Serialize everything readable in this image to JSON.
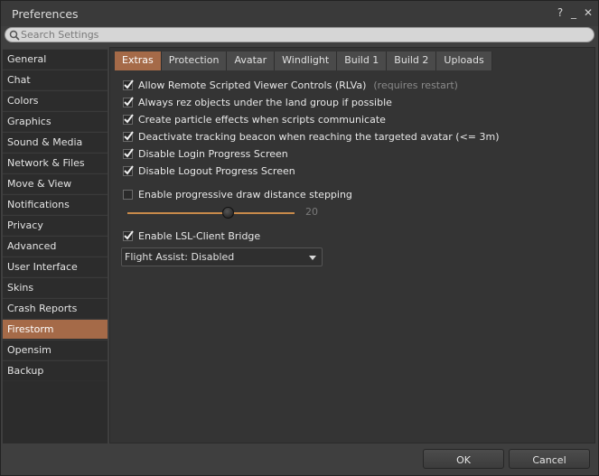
{
  "window": {
    "title": "Preferences",
    "help_glyph": "?",
    "minimize_glyph": "_",
    "close_glyph": "✕"
  },
  "search": {
    "placeholder": "Search Settings",
    "value": ""
  },
  "sidebar": {
    "items": [
      {
        "label": "General"
      },
      {
        "label": "Chat"
      },
      {
        "label": "Colors"
      },
      {
        "label": "Graphics"
      },
      {
        "label": "Sound & Media"
      },
      {
        "label": "Network & Files"
      },
      {
        "label": "Move & View"
      },
      {
        "label": "Notifications"
      },
      {
        "label": "Privacy"
      },
      {
        "label": "Advanced"
      },
      {
        "label": "User Interface"
      },
      {
        "label": "Skins"
      },
      {
        "label": "Crash Reports"
      },
      {
        "label": "Firestorm"
      },
      {
        "label": "Opensim"
      },
      {
        "label": "Backup"
      }
    ],
    "active": "Firestorm"
  },
  "tabs": {
    "items": [
      {
        "label": "Extras"
      },
      {
        "label": "Protection"
      },
      {
        "label": "Avatar"
      },
      {
        "label": "Windlight"
      },
      {
        "label": "Build 1"
      },
      {
        "label": "Build 2"
      },
      {
        "label": "Uploads"
      }
    ],
    "active": "Extras"
  },
  "options": {
    "rlva": {
      "label": "Allow Remote Scripted Viewer Controls (RLVa)",
      "hint": "(requires restart)",
      "checked": true
    },
    "rez_land_group": {
      "label": "Always rez objects under the land group if possible",
      "checked": true
    },
    "particle_effects": {
      "label": "Create particle effects when scripts communicate",
      "checked": true
    },
    "tracking_beacon": {
      "label": "Deactivate tracking beacon when reaching the targeted avatar (<= 3m)",
      "checked": true
    },
    "login_progress": {
      "label": "Disable Login Progress Screen",
      "checked": true
    },
    "logout_progress": {
      "label": "Disable Logout Progress Screen",
      "checked": true
    },
    "progressive_draw": {
      "label": "Enable progressive draw distance stepping",
      "checked": false
    },
    "lsl_bridge": {
      "label": "Enable LSL-Client Bridge",
      "checked": true
    }
  },
  "slider": {
    "value": "20",
    "fraction": 0.6
  },
  "flight_assist": {
    "selected": "Flight Assist: Disabled"
  },
  "buttons": {
    "ok": "OK",
    "cancel": "Cancel"
  },
  "colors": {
    "accent": "#a56a48",
    "slider_track": "#c88a4a"
  }
}
